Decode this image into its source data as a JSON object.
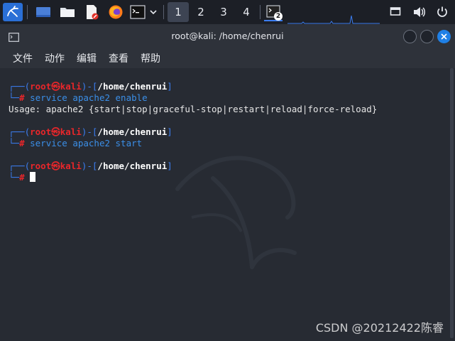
{
  "taskbar": {
    "workspaces": [
      "1",
      "2",
      "3",
      "4"
    ],
    "active_workspace": "1",
    "terminal_badge": "2",
    "icons": [
      "kali-menu-icon",
      "show-desktop-icon",
      "file-manager-icon",
      "text-editor-icon",
      "firefox-icon",
      "terminal-icon",
      "chevron-down-icon",
      "terminal-task-icon",
      "display-icon",
      "volume-icon",
      "power-icon"
    ]
  },
  "window": {
    "title": "root@kali: /home/chenrui"
  },
  "menu": {
    "items": [
      "文件",
      "动作",
      "编辑",
      "查看",
      "帮助"
    ]
  },
  "terminal": {
    "prompt_user": "root",
    "prompt_at": "㉿",
    "prompt_host": "kali",
    "prompt_path": "/home/chenrui",
    "prompt_symbol": "#",
    "cmd1": "service apache2 enable",
    "output1": "Usage: apache2 {start|stop|graceful-stop|restart|reload|force-reload}",
    "cmd2": "service apache2 start"
  },
  "watermark": "CSDN @20212422陈睿",
  "colors": {
    "panel": "#1c1f26",
    "window": "#272b33",
    "prompt_blue": "#3b7df0",
    "prompt_red": "#e8262a",
    "close_button": "#1f80e6"
  }
}
